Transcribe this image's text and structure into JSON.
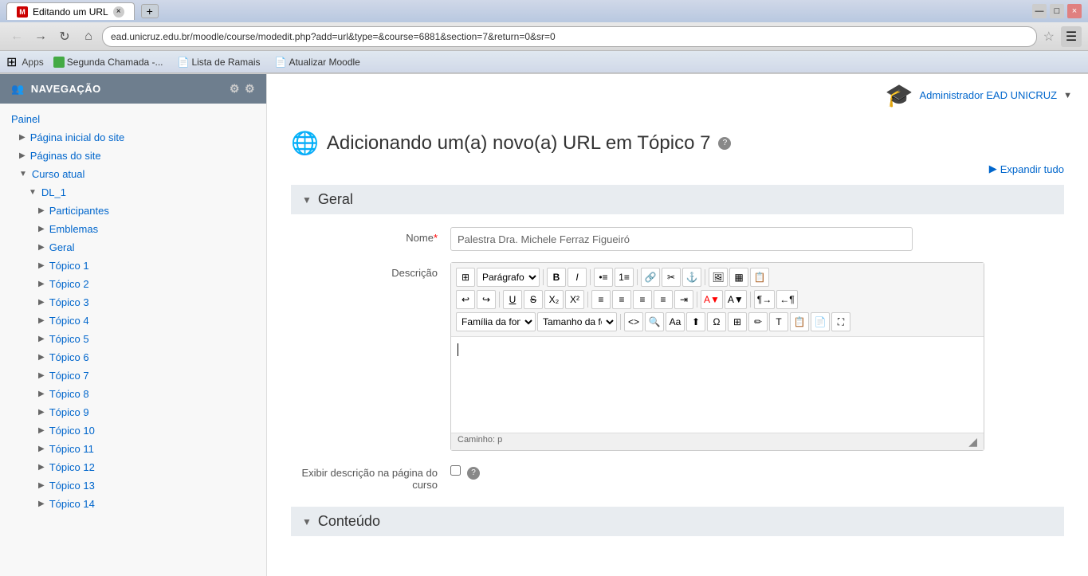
{
  "browser": {
    "tab_title": "Editando um URL",
    "tab_favicon": "M",
    "address_bar": "ead.unicruz.edu.br/moodle/course/modedit.php?add=url&type=&course=6881&section=7&return=0&sr=0",
    "new_tab_symbol": "+"
  },
  "bookmarks": {
    "apps_label": "Apps",
    "links": [
      {
        "label": "Segunda Chamada -...",
        "has_icon": true
      },
      {
        "label": "Lista de Ramais",
        "has_icon": false
      },
      {
        "label": "Atualizar Moodle",
        "has_icon": false
      }
    ]
  },
  "user": {
    "name": "Administrador EAD UNICRUZ",
    "avatar": "🎓"
  },
  "page": {
    "title": "Adicionando um(a) novo(a) URL em Tópico 7",
    "expand_all": "Expandir tudo"
  },
  "sections": {
    "geral": {
      "label": "Geral",
      "nome_label": "Nome",
      "nome_value": "Palestra Dra. Michele Ferraz Figueiró",
      "descricao_label": "Descrição",
      "paragrafo_option": "Parágrafo",
      "font_family_label": "Família da fon▼",
      "font_size_label": "Tamanho da fc▼",
      "caminho_label": "Caminho: p",
      "exibir_label": "Exibir descrição na página do curso"
    },
    "conteudo": {
      "label": "Conteúdo"
    }
  },
  "sidebar": {
    "title": "NAVEGAÇÃO",
    "items": [
      {
        "level": 0,
        "label": "Painel",
        "type": "link"
      },
      {
        "level": 1,
        "label": "Página inicial do site",
        "type": "arrow-link"
      },
      {
        "level": 1,
        "label": "Páginas do site",
        "type": "arrow-link"
      },
      {
        "level": 1,
        "label": "Curso atual",
        "type": "arrow-down-link"
      },
      {
        "level": 2,
        "label": "DL_1",
        "type": "arrow-down"
      },
      {
        "level": 3,
        "label": "Participantes",
        "type": "arrow-link"
      },
      {
        "level": 3,
        "label": "Emblemas",
        "type": "arrow-link"
      },
      {
        "level": 3,
        "label": "Geral",
        "type": "arrow-link"
      },
      {
        "level": 3,
        "label": "Tópico 1",
        "type": "arrow-link"
      },
      {
        "level": 3,
        "label": "Tópico 2",
        "type": "arrow-link"
      },
      {
        "level": 3,
        "label": "Tópico 3",
        "type": "arrow-link"
      },
      {
        "level": 3,
        "label": "Tópico 4",
        "type": "arrow-link"
      },
      {
        "level": 3,
        "label": "Tópico 5",
        "type": "arrow-link"
      },
      {
        "level": 3,
        "label": "Tópico 6",
        "type": "arrow-link"
      },
      {
        "level": 3,
        "label": "Tópico 7",
        "type": "arrow-link"
      },
      {
        "level": 3,
        "label": "Tópico 8",
        "type": "arrow-link"
      },
      {
        "level": 3,
        "label": "Tópico 9",
        "type": "arrow-link"
      },
      {
        "level": 3,
        "label": "Tópico 10",
        "type": "arrow-link"
      },
      {
        "level": 3,
        "label": "Tópico 11",
        "type": "arrow-link"
      },
      {
        "level": 3,
        "label": "Tópico 12",
        "type": "arrow-link"
      },
      {
        "level": 3,
        "label": "Tópico 13",
        "type": "arrow-link"
      },
      {
        "level": 3,
        "label": "Tópico 14",
        "type": "arrow-link"
      }
    ]
  },
  "rte": {
    "toolbar_row1": [
      "⊞",
      "Parágrafo",
      "▼",
      "B",
      "I",
      "•≡",
      "#≡",
      "🔗",
      "🔗x",
      "□",
      "🖼",
      "⬛",
      "📋"
    ],
    "toolbar_row2": [
      "↩",
      "↪",
      "U",
      "S",
      "X₂",
      "X²",
      "≡",
      "≡",
      "≡",
      "≡",
      "≡",
      "A▼",
      "A▼",
      "¶",
      "¶"
    ],
    "toolbar_row3": [
      "Família da fon",
      "▼",
      "Tamanho da fc",
      "▼",
      "<>",
      "🔍",
      "Aa",
      "⬆",
      "Ω",
      "⊞",
      "✏",
      "T",
      "📋",
      "📋",
      "⛶"
    ]
  }
}
